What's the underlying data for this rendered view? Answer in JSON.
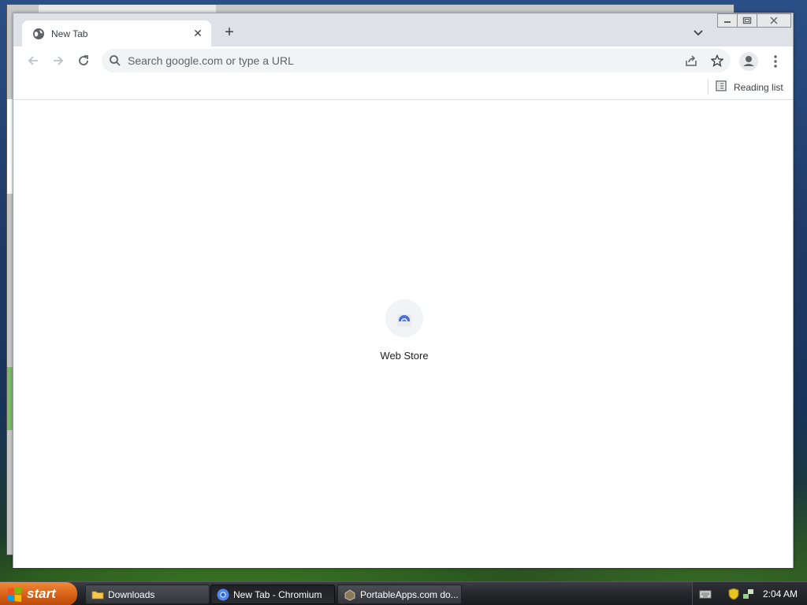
{
  "browser": {
    "tab": {
      "title": "New Tab",
      "favicon": "globe-icon"
    },
    "omnibox": {
      "placeholder": "Search google.com or type a URL",
      "value": ""
    },
    "bookmarks_bar": {
      "reading_list_label": "Reading list"
    },
    "shortcuts": [
      {
        "label": "Web Store",
        "icon": "web-store-icon"
      }
    ]
  },
  "taskbar": {
    "start_label": "start",
    "tasks": [
      {
        "label": "Downloads",
        "icon": "folder-icon"
      },
      {
        "label": "New Tab - Chromium",
        "icon": "chromium-icon"
      },
      {
        "label": "PortableApps.com do...",
        "icon": "portableapps-icon"
      }
    ],
    "clock": "2:04 AM"
  },
  "colors": {
    "tabstrip": "#dee1e6",
    "omnibox": "#f1f3f4",
    "start_button": "#d35d12",
    "taskbar": "#25272b"
  }
}
